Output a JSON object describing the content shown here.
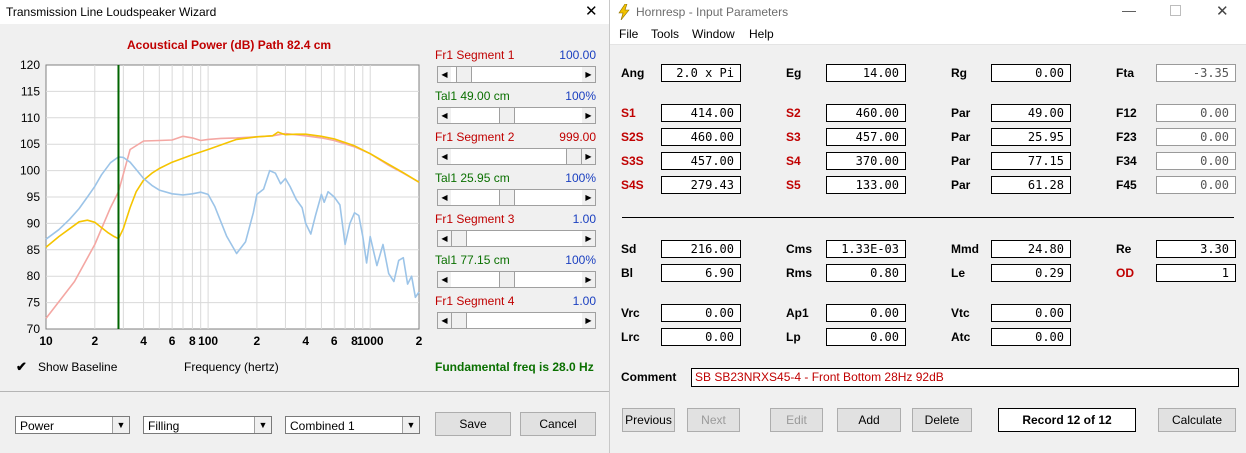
{
  "left_window": {
    "title": "Transmission Line Loudspeaker Wizard",
    "chart_title": "Acoustical Power (dB)   Path 82.4 cm",
    "show_baseline_label": "Show Baseline",
    "show_baseline_checked": "✔",
    "frequency_label": "Frequency (hertz)",
    "fundamental": "Fundamental freq is 28.0 Hz",
    "sliders": [
      {
        "label": "Fr1  Segment 1",
        "value": "100.00",
        "color": "#c00000",
        "value_color": "#1a3fc0",
        "position": 0.04
      },
      {
        "label": "Tal1  49.00 cm",
        "value": "100%",
        "color": "#0a7000",
        "value_color": "#1a3fc0",
        "position": 0.42
      },
      {
        "label": "Fr1  Segment 2",
        "value": "999.00",
        "color": "#c00000",
        "value_color": "#c00000",
        "position": 1.0
      },
      {
        "label": "Tal1  25.95 cm",
        "value": "100%",
        "color": "#0a7000",
        "value_color": "#1a3fc0",
        "position": 0.42
      },
      {
        "label": "Fr1  Segment 3",
        "value": "1.00",
        "color": "#c00000",
        "value_color": "#1a3fc0",
        "position": 0.0
      },
      {
        "label": "Tal1  77.15 cm",
        "value": "100%",
        "color": "#0a7000",
        "value_color": "#1a3fc0",
        "position": 0.42
      },
      {
        "label": "Fr1  Segment 4",
        "value": "1.00",
        "color": "#c00000",
        "value_color": "#1a3fc0",
        "position": 0.0
      }
    ],
    "combos": [
      "Power",
      "Filling",
      "Combined 1"
    ],
    "save_label": "Save",
    "cancel_label": "Cancel"
  },
  "chart_data": {
    "type": "line",
    "title": "Acoustical Power (dB)   Path 82.4 cm",
    "xlabel": "Frequency (hertz)",
    "ylabel": "",
    "xscale": "log",
    "xlim": [
      10,
      2000
    ],
    "ylim": [
      70,
      120
    ],
    "yticks": [
      70,
      75,
      80,
      85,
      90,
      95,
      100,
      105,
      110,
      115,
      120
    ],
    "xtick_labels": [
      {
        "x": 10,
        "label": "10"
      },
      {
        "x": 20,
        "label": "2"
      },
      {
        "x": 40,
        "label": "4"
      },
      {
        "x": 60,
        "label": "6"
      },
      {
        "x": 80,
        "label": "8"
      },
      {
        "x": 100,
        "label": "100"
      },
      {
        "x": 200,
        "label": "2"
      },
      {
        "x": 400,
        "label": "4"
      },
      {
        "x": 600,
        "label": "6"
      },
      {
        "x": 800,
        "label": "8"
      },
      {
        "x": 1000,
        "label": "1000"
      },
      {
        "x": 2000,
        "label": "2"
      }
    ],
    "grid": true,
    "marker_frequency": 28,
    "series": [
      {
        "color": "#f4a7a3",
        "x": [
          10,
          15,
          20,
          25,
          28,
          33,
          40,
          50,
          60,
          70,
          80,
          90,
          100,
          120,
          150,
          200,
          250,
          300,
          400,
          500,
          600,
          800,
          1000,
          1300,
          1600,
          2000
        ],
        "y": [
          72,
          79,
          86,
          93,
          96,
          104,
          105.6,
          105.7,
          105.8,
          106.5,
          106.2,
          105.7,
          105.9,
          106.1,
          106.2,
          106.4,
          106.6,
          107,
          106.6,
          106.2,
          105.7,
          104.5,
          103.2,
          101,
          99.5,
          97.8
        ]
      },
      {
        "color": "#f5c400",
        "x": [
          10,
          12,
          14,
          16,
          18,
          20,
          22,
          24,
          26,
          28,
          30,
          33,
          36,
          40,
          45,
          50,
          60,
          80,
          100,
          150,
          200,
          250,
          270,
          300,
          350,
          400,
          500,
          600,
          800,
          1000,
          1300,
          1600,
          2000
        ],
        "y": [
          85.5,
          87.5,
          89,
          90.3,
          90.6,
          90.2,
          89.2,
          88.3,
          87.6,
          87.1,
          89,
          93,
          96,
          98.2,
          99.5,
          100.4,
          101.6,
          103,
          104,
          105.9,
          106.4,
          106.6,
          107.3,
          106.8,
          106.9,
          106.9,
          106.5,
          106,
          104.7,
          103.2,
          101.2,
          99.6,
          97.8
        ]
      },
      {
        "color": "#9cc4e8",
        "x": [
          10,
          12,
          14,
          16,
          18,
          20,
          22,
          25,
          28,
          30,
          33,
          36,
          40,
          45,
          50,
          60,
          70,
          80,
          90,
          100,
          110,
          120,
          130,
          150,
          170,
          190,
          200,
          220,
          240,
          260,
          280,
          300,
          320,
          350,
          380,
          400,
          430,
          460,
          500,
          520,
          550,
          600,
          650,
          700,
          750,
          800,
          850,
          900,
          950,
          1000,
          1100,
          1200,
          1300,
          1400,
          1500,
          1600,
          1700,
          1800,
          1900,
          2000
        ],
        "y": [
          87,
          88.8,
          90.8,
          92.8,
          95,
          97,
          99.2,
          101.5,
          102.6,
          102.5,
          101.6,
          100.2,
          98.5,
          97.2,
          96.3,
          95.6,
          95.4,
          95.6,
          95.9,
          95.5,
          93.2,
          90.3,
          87.6,
          84.3,
          86.5,
          92,
          95.5,
          96.5,
          100,
          99.5,
          97.5,
          98.5,
          97,
          94.5,
          93,
          90,
          88,
          91.5,
          95.5,
          94,
          96,
          95,
          93.5,
          86,
          90,
          92,
          91.5,
          87.5,
          82.5,
          87.5,
          82,
          86,
          80.5,
          79,
          83,
          83.5,
          78.5,
          80,
          76,
          77
        ]
      }
    ]
  },
  "right_window": {
    "title": "Hornresp - Input Parameters",
    "menu": [
      "File",
      "Tools",
      "Window",
      "Help"
    ],
    "params": [
      {
        "label": "Ang",
        "value": "2.0 x Pi",
        "red": false
      },
      {
        "label": "Eg",
        "value": "14.00",
        "red": false
      },
      {
        "label": "Rg",
        "value": "0.00",
        "red": false
      },
      {
        "label": "Fta",
        "value": "-3.35",
        "red": false,
        "readonly": true
      },
      {
        "label": "S1",
        "value": "414.00",
        "red": true
      },
      {
        "label": "S2",
        "value": "460.00",
        "red": true
      },
      {
        "label": "Par",
        "value": "49.00",
        "red": false
      },
      {
        "label": "F12",
        "value": "0.00",
        "red": false,
        "readonly": true
      },
      {
        "label": "S2S",
        "value": "460.00",
        "red": true
      },
      {
        "label": "S3",
        "value": "457.00",
        "red": true
      },
      {
        "label": "Par",
        "value": "25.95",
        "red": false
      },
      {
        "label": "F23",
        "value": "0.00",
        "red": false,
        "readonly": true
      },
      {
        "label": "S3S",
        "value": "457.00",
        "red": true
      },
      {
        "label": "S4",
        "value": "370.00",
        "red": true
      },
      {
        "label": "Par",
        "value": "77.15",
        "red": false
      },
      {
        "label": "F34",
        "value": "0.00",
        "red": false,
        "readonly": true
      },
      {
        "label": "S4S",
        "value": "279.43",
        "red": true
      },
      {
        "label": "S5",
        "value": "133.00",
        "red": true
      },
      {
        "label": "Par",
        "value": "61.28",
        "red": false
      },
      {
        "label": "F45",
        "value": "0.00",
        "red": false,
        "readonly": true
      },
      {
        "label": "Sd",
        "value": "216.00",
        "red": false
      },
      {
        "label": "Cms",
        "value": "1.33E-03",
        "red": false
      },
      {
        "label": "Mmd",
        "value": "24.80",
        "red": false
      },
      {
        "label": "Re",
        "value": "3.30",
        "red": false
      },
      {
        "label": "Bl",
        "value": "6.90",
        "red": false
      },
      {
        "label": "Rms",
        "value": "0.80",
        "red": false
      },
      {
        "label": "Le",
        "value": "0.29",
        "red": false
      },
      {
        "label": "OD",
        "value": "1",
        "red": true
      },
      {
        "label": "Vrc",
        "value": "0.00",
        "red": false
      },
      {
        "label": "Ap1",
        "value": "0.00",
        "red": false
      },
      {
        "label": "Vtc",
        "value": "0.00",
        "red": false
      },
      {
        "label": "Lrc",
        "value": "0.00",
        "red": false
      },
      {
        "label": "Lp",
        "value": "0.00",
        "red": false
      },
      {
        "label": "Atc",
        "value": "0.00",
        "red": false
      }
    ],
    "comment_label": "Comment",
    "comment_value": "SB SB23NRXS45-4 - Front Bottom 28Hz 92dB",
    "buttons": {
      "previous": "Previous",
      "next": "Next",
      "edit": "Edit",
      "add": "Add",
      "delete": "Delete",
      "calculate": "Calculate"
    },
    "record": "Record 12 of 12"
  }
}
